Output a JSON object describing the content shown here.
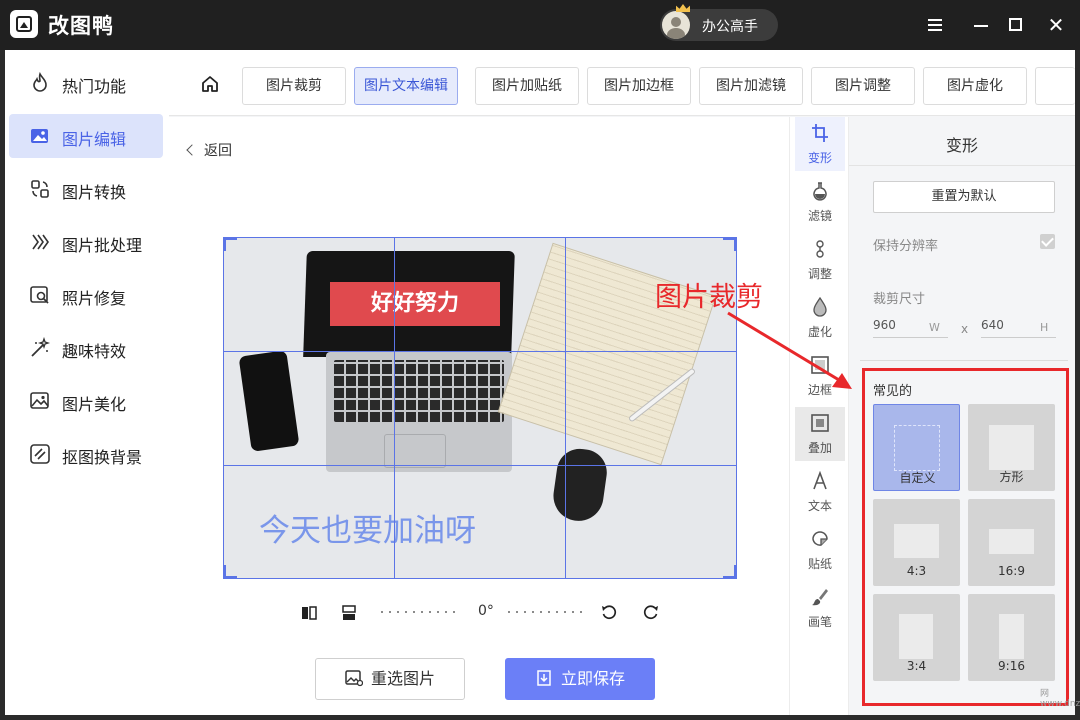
{
  "app": {
    "title": "改图鸭",
    "user_name": "办公高手"
  },
  "sidebar": {
    "items": [
      {
        "label": "热门功能",
        "active": false
      },
      {
        "label": "图片编辑",
        "active": true
      },
      {
        "label": "图片转换",
        "active": false
      },
      {
        "label": "图片批处理",
        "active": false
      },
      {
        "label": "照片修复",
        "active": false
      },
      {
        "label": "趣味特效",
        "active": false
      },
      {
        "label": "图片美化",
        "active": false
      },
      {
        "label": "抠图换背景",
        "active": false
      }
    ]
  },
  "tabs": [
    {
      "label": "图片裁剪",
      "active": false
    },
    {
      "label": "图片文本编辑",
      "active": true
    },
    {
      "label": "图片加贴纸",
      "active": false
    },
    {
      "label": "图片加边框",
      "active": false
    },
    {
      "label": "图片加滤镜",
      "active": false
    },
    {
      "label": "图片调整",
      "active": false
    },
    {
      "label": "图片虚化",
      "active": false
    }
  ],
  "canvas": {
    "back_label": "返回",
    "banner_text": "好好努力",
    "overlay_text": "今天也要加油呀",
    "rotation": "0°"
  },
  "actions": {
    "reselect_label": "重选图片",
    "save_label": "立即保存"
  },
  "tools": [
    {
      "label": "变形",
      "active": true
    },
    {
      "label": "滤镜",
      "active": false
    },
    {
      "label": "调整",
      "active": false
    },
    {
      "label": "虚化",
      "active": false
    },
    {
      "label": "边框",
      "active": false
    },
    {
      "label": "叠加",
      "active": false
    },
    {
      "label": "文本",
      "active": false
    },
    {
      "label": "贴纸",
      "active": false
    },
    {
      "label": "画笔",
      "active": false
    }
  ],
  "panel": {
    "title": "变形",
    "reset_label": "重置为默认",
    "keep_resolution_label": "保持分辨率",
    "crop_size_label": "裁剪尺寸",
    "width": "960",
    "width_unit": "W",
    "sep": "x",
    "height": "640",
    "height_unit": "H",
    "presets_title": "常见的",
    "presets": [
      {
        "label": "自定义",
        "active": true
      },
      {
        "label": "方形",
        "active": false
      },
      {
        "label": "4:3",
        "active": false
      },
      {
        "label": "16:9",
        "active": false
      },
      {
        "label": "3:4",
        "active": false
      },
      {
        "label": "9:16",
        "active": false
      }
    ]
  },
  "annotation": {
    "text": "图片裁剪"
  },
  "watermark": {
    "text": "网 www.dnzp.com"
  },
  "colors": {
    "accent": "#4a63e6",
    "save": "#6b7ff7",
    "annotation": "#e8282b",
    "titlebar": "#202020"
  }
}
